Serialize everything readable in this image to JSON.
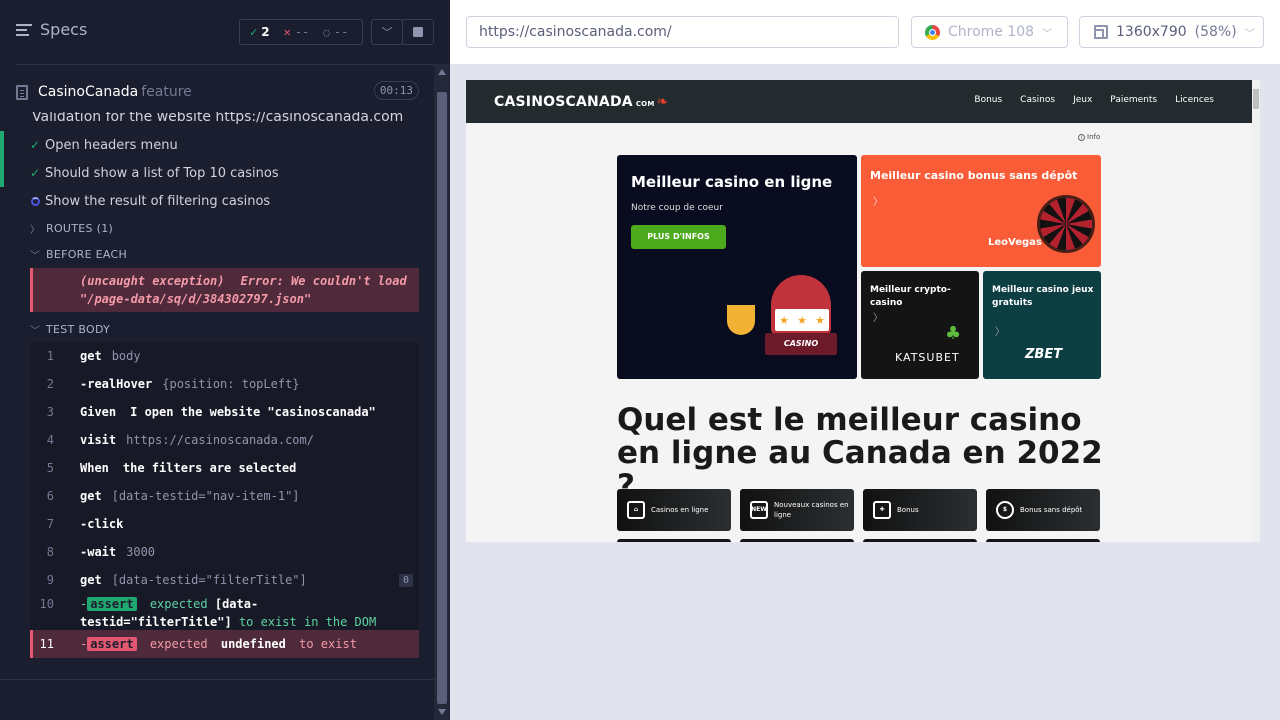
{
  "reporter": {
    "title": "Specs",
    "stats": {
      "passed": "2",
      "failed": "--",
      "pending": "--"
    },
    "spec": {
      "name": "CasinoCanada",
      "ext": "feature",
      "duration": "00:13"
    },
    "suite_title": "Validation for the website https://casinoscanada.com",
    "tests": [
      {
        "label": "Open headers menu",
        "state": "passed"
      },
      {
        "label": "Should show a list of Top 10 casinos",
        "state": "passed"
      },
      {
        "label": "Show the result of filtering casinos",
        "state": "running"
      }
    ],
    "routes_label": "ROUTES (1)",
    "before_each_label": "BEFORE EACH",
    "error": {
      "type": "(uncaught exception)",
      "line1": "Error: We couldn't load",
      "line2": "\"/page-data/sq/d/384302797.json\""
    },
    "test_body_label": "TEST BODY",
    "commands": [
      {
        "num": "1",
        "name": "get",
        "arg": "body"
      },
      {
        "num": "2",
        "name": "-realHover",
        "arg": "{position: topLeft}"
      },
      {
        "num": "3",
        "name": "Given",
        "arg": "I open the website \"casinoscanada\""
      },
      {
        "num": "4",
        "name": "visit",
        "arg": "https://casinoscanada.com/"
      },
      {
        "num": "5",
        "name": "When",
        "arg": "the filters are selected"
      },
      {
        "num": "6",
        "name": "get",
        "arg": "[data-testid=\"nav-item-1\"]"
      },
      {
        "num": "7",
        "name": "-click",
        "arg": ""
      },
      {
        "num": "8",
        "name": "-wait",
        "arg": "3000"
      },
      {
        "num": "9",
        "name": "get",
        "arg": "[data-testid=\"filterTitle\"]",
        "badge": "0"
      },
      {
        "num": "10",
        "prefix": "-",
        "tag": "assert",
        "w1": "expected",
        "w2": "[data-",
        "w3": "testid=\"filterTitle\"]",
        "w4": "to exist in the DOM"
      },
      {
        "num": "11",
        "prefix": "-",
        "tag": "assert",
        "w1": "expected",
        "w2": "undefined",
        "w3": "to exist"
      }
    ]
  },
  "aut": {
    "url": "https://casinoscanada.com/",
    "browser": "Chrome 108",
    "viewport": "1360x790",
    "scale": "(58%)"
  },
  "site": {
    "logo": "CASINOSCANADA",
    "logo_com": "COM",
    "nav": [
      "Bonus",
      "Casinos",
      "Jeux",
      "Paiements",
      "Licences"
    ],
    "info": "Info",
    "card_main": {
      "title": "Meilleur casino en ligne",
      "subtitle": "Notre coup de coeur",
      "button": "PLUS D'INFOS",
      "slot_text": "CASINO"
    },
    "card_orange": {
      "title": "Meilleur casino bonus sans dépôt",
      "brand": "LeoVegas"
    },
    "card_dark": {
      "title": "Meilleur crypto-casino",
      "brand": "KATSUBET"
    },
    "card_teal": {
      "title": "Meilleur casino jeux gratuits",
      "brand": "ZBET"
    },
    "heading": "Quel est le meilleur casino en ligne au Canada en 2022 ?",
    "categories": [
      {
        "label": "Casinos en ligne",
        "icon": "bank-icon"
      },
      {
        "label": "Nouveaux casinos en ligne",
        "icon": "new-icon"
      },
      {
        "label": "Bonus",
        "icon": "gift-icon"
      },
      {
        "label": "Bonus sans dépôt",
        "icon": "coin-icon"
      }
    ]
  }
}
